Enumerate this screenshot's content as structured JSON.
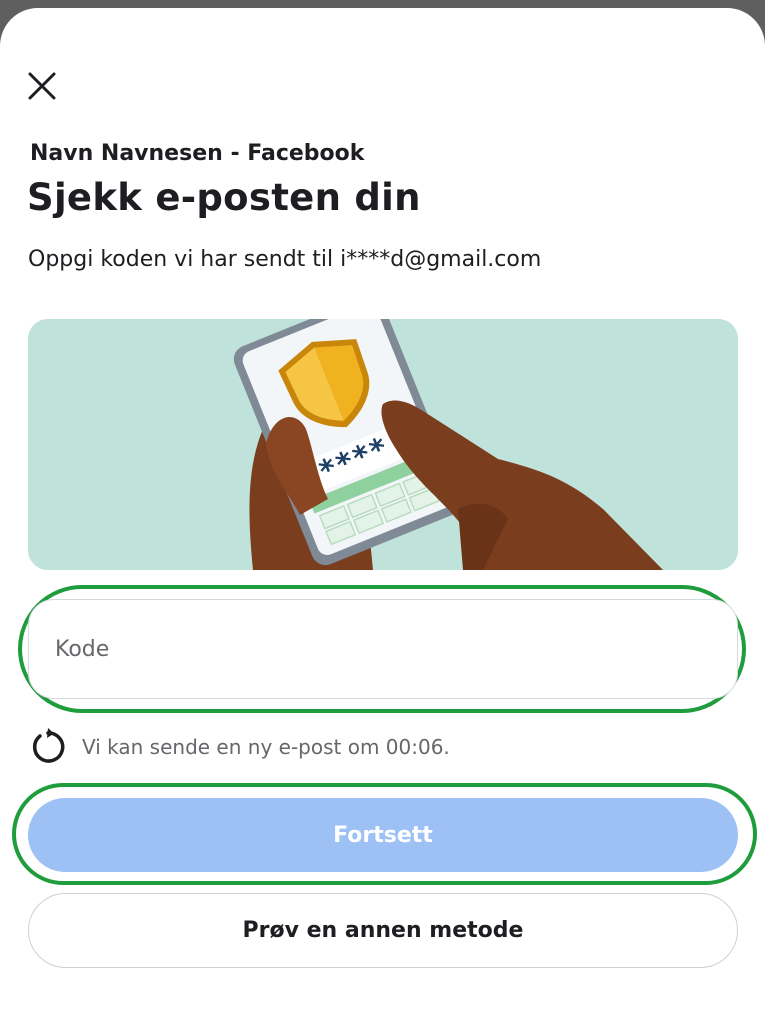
{
  "header": {
    "close_icon": "close-icon",
    "account_name": "Navn Navnesen - Facebook",
    "title": "Sjekk e-posten din",
    "subtitle": "Oppgi koden vi har sendt til i****d@gmail.com"
  },
  "illustration": {
    "masked_code": "****",
    "shield_icon": "shield-icon"
  },
  "code_field": {
    "placeholder": "Kode",
    "value": ""
  },
  "resend": {
    "icon": "refresh-icon",
    "text": "Vi kan sende en ny e-post om 00:06."
  },
  "buttons": {
    "continue_label": "Fortsett",
    "alternative_label": "Prøv en annen metode"
  },
  "colors": {
    "primary_disabled": "#9ec1f5",
    "highlight": "#1f9c3b",
    "illustration_bg": "#bfe3da"
  }
}
